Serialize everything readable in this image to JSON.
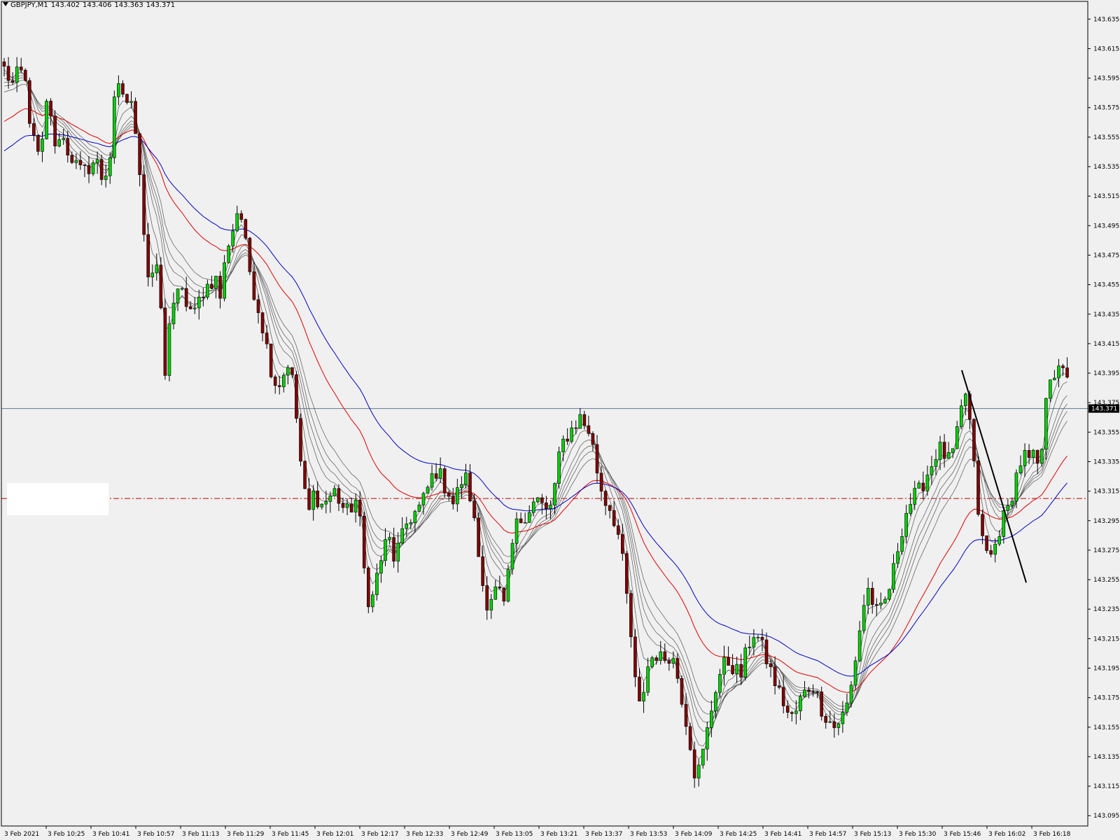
{
  "window": {
    "symbol": "GBPJPY,M1",
    "ohlc": [
      "143.402",
      "143.406",
      "143.363",
      "143.371"
    ]
  },
  "colors": {
    "background": "#f0f0f0",
    "bull": "#00d000",
    "bear": "#800000",
    "ema_red": "#e00000",
    "ema_blue": "#0000c8",
    "ema_gray": "#555555",
    "bid_line": "#607890",
    "level_line": "#c00000",
    "trendline": "#000000"
  },
  "chart_data": {
    "type": "candlestick",
    "y_range": [
      143.088,
      143.647
    ],
    "y_ticks": [
      "143.635",
      "143.615",
      "143.595",
      "143.575",
      "143.555",
      "143.535",
      "143.515",
      "143.495",
      "143.475",
      "143.455",
      "143.435",
      "143.415",
      "143.395",
      "143.375",
      "143.355",
      "143.335",
      "143.315",
      "143.295",
      "143.275",
      "143.255",
      "143.235",
      "143.215",
      "143.195",
      "143.175",
      "143.155",
      "143.135",
      "143.115",
      "143.095"
    ],
    "x_ticks": [
      "3 Feb 2021",
      "3 Feb 10:25",
      "3 Feb 10:41",
      "3 Feb 10:57",
      "3 Feb 11:13",
      "3 Feb 11:29",
      "3 Feb 11:45",
      "3 Feb 12:01",
      "3 Feb 12:17",
      "3 Feb 12:33",
      "3 Feb 12:49",
      "3 Feb 13:05",
      "3 Feb 13:21",
      "3 Feb 13:37",
      "3 Feb 13:53",
      "3 Feb 14:09",
      "3 Feb 14:25",
      "3 Feb 14:41",
      "3 Feb 14:57",
      "3 Feb 15:13",
      "3 Feb 15:30",
      "3 Feb 15:46",
      "3 Feb 16:02",
      "3 Feb 16:18"
    ],
    "bid_price": "143.371",
    "level_price": 143.31,
    "trendline": {
      "from": [
        1402,
        143.397
      ],
      "to": [
        1496,
        143.253
      ]
    },
    "anchors": [
      [
        0,
        143.605
      ],
      [
        8,
        143.6
      ],
      [
        18,
        143.59
      ],
      [
        28,
        143.6
      ],
      [
        36,
        143.595
      ],
      [
        44,
        143.565
      ],
      [
        52,
        143.545
      ],
      [
        60,
        143.54
      ],
      [
        66,
        143.575
      ],
      [
        72,
        143.58
      ],
      [
        80,
        143.545
      ],
      [
        88,
        143.56
      ],
      [
        96,
        143.548
      ],
      [
        104,
        143.542
      ],
      [
        112,
        143.535
      ],
      [
        120,
        143.53
      ],
      [
        130,
        143.535
      ],
      [
        140,
        143.54
      ],
      [
        150,
        143.525
      ],
      [
        160,
        143.54
      ],
      [
        168,
        143.585
      ],
      [
        176,
        143.588
      ],
      [
        184,
        143.58
      ],
      [
        192,
        143.575
      ],
      [
        200,
        143.555
      ],
      [
        206,
        143.52
      ],
      [
        212,
        143.475
      ],
      [
        218,
        143.455
      ],
      [
        226,
        143.47
      ],
      [
        234,
        143.445
      ],
      [
        240,
        143.385
      ],
      [
        246,
        143.43
      ],
      [
        254,
        143.445
      ],
      [
        264,
        143.45
      ],
      [
        274,
        143.44
      ],
      [
        284,
        143.435
      ],
      [
        294,
        143.45
      ],
      [
        304,
        143.455
      ],
      [
        314,
        143.46
      ],
      [
        322,
        143.445
      ],
      [
        330,
        143.48
      ],
      [
        338,
        143.49
      ],
      [
        346,
        143.505
      ],
      [
        352,
        143.5
      ],
      [
        360,
        143.475
      ],
      [
        368,
        143.455
      ],
      [
        376,
        143.44
      ],
      [
        386,
        143.42
      ],
      [
        394,
        143.4
      ],
      [
        404,
        143.385
      ],
      [
        414,
        143.395
      ],
      [
        422,
        143.405
      ],
      [
        430,
        143.375
      ],
      [
        436,
        143.345
      ],
      [
        442,
        143.318
      ],
      [
        450,
        143.3
      ],
      [
        458,
        143.315
      ],
      [
        468,
        143.305
      ],
      [
        478,
        143.31
      ],
      [
        488,
        143.315
      ],
      [
        498,
        143.305
      ],
      [
        508,
        143.3
      ],
      [
        518,
        143.31
      ],
      [
        526,
        143.29
      ],
      [
        532,
        143.255
      ],
      [
        540,
        143.235
      ],
      [
        548,
        143.255
      ],
      [
        556,
        143.27
      ],
      [
        566,
        143.285
      ],
      [
        574,
        143.27
      ],
      [
        584,
        143.28
      ],
      [
        594,
        143.295
      ],
      [
        604,
        143.3
      ],
      [
        614,
        143.305
      ],
      [
        622,
        143.315
      ],
      [
        630,
        143.325
      ],
      [
        638,
        143.33
      ],
      [
        646,
        143.32
      ],
      [
        654,
        143.315
      ],
      [
        662,
        143.305
      ],
      [
        670,
        143.32
      ],
      [
        678,
        143.325
      ],
      [
        686,
        143.31
      ],
      [
        694,
        143.285
      ],
      [
        702,
        143.255
      ],
      [
        710,
        143.24
      ],
      [
        718,
        143.245
      ],
      [
        726,
        143.25
      ],
      [
        734,
        143.235
      ],
      [
        742,
        143.26
      ],
      [
        750,
        143.29
      ],
      [
        758,
        143.295
      ],
      [
        766,
        143.3
      ],
      [
        774,
        143.305
      ],
      [
        782,
        143.31
      ],
      [
        790,
        143.305
      ],
      [
        798,
        143.3
      ],
      [
        806,
        143.31
      ],
      [
        814,
        143.335
      ],
      [
        822,
        143.35
      ],
      [
        830,
        143.355
      ],
      [
        838,
        143.36
      ],
      [
        846,
        143.365
      ],
      [
        852,
        143.36
      ],
      [
        860,
        143.355
      ],
      [
        866,
        143.34
      ],
      [
        872,
        143.325
      ],
      [
        880,
        143.31
      ],
      [
        888,
        143.305
      ],
      [
        896,
        143.295
      ],
      [
        904,
        143.28
      ],
      [
        912,
        143.25
      ],
      [
        918,
        143.225
      ],
      [
        924,
        143.195
      ],
      [
        930,
        143.165
      ],
      [
        938,
        143.18
      ],
      [
        946,
        143.2
      ],
      [
        956,
        143.205
      ],
      [
        966,
        143.2
      ],
      [
        974,
        143.205
      ],
      [
        982,
        143.2
      ],
      [
        990,
        143.185
      ],
      [
        998,
        143.165
      ],
      [
        1006,
        143.145
      ],
      [
        1012,
        143.125
      ],
      [
        1018,
        143.125
      ],
      [
        1026,
        143.14
      ],
      [
        1034,
        143.16
      ],
      [
        1042,
        143.18
      ],
      [
        1052,
        143.195
      ],
      [
        1060,
        143.2
      ],
      [
        1070,
        143.195
      ],
      [
        1080,
        143.19
      ],
      [
        1090,
        143.21
      ],
      [
        1100,
        143.22
      ],
      [
        1110,
        143.21
      ],
      [
        1118,
        143.2
      ],
      [
        1126,
        143.19
      ],
      [
        1134,
        143.18
      ],
      [
        1144,
        143.17
      ],
      [
        1152,
        143.16
      ],
      [
        1160,
        143.165
      ],
      [
        1168,
        143.175
      ],
      [
        1176,
        143.18
      ],
      [
        1184,
        143.185
      ],
      [
        1192,
        143.175
      ],
      [
        1200,
        143.165
      ],
      [
        1208,
        143.16
      ],
      [
        1216,
        143.155
      ],
      [
        1224,
        143.16
      ],
      [
        1232,
        143.165
      ],
      [
        1240,
        143.18
      ],
      [
        1248,
        143.205
      ],
      [
        1256,
        143.23
      ],
      [
        1264,
        143.25
      ],
      [
        1272,
        143.24
      ],
      [
        1280,
        143.23
      ],
      [
        1290,
        143.24
      ],
      [
        1300,
        143.255
      ],
      [
        1310,
        143.28
      ],
      [
        1320,
        143.3
      ],
      [
        1330,
        143.31
      ],
      [
        1340,
        143.315
      ],
      [
        1350,
        143.325
      ],
      [
        1360,
        143.335
      ],
      [
        1368,
        143.345
      ],
      [
        1376,
        143.34
      ],
      [
        1384,
        143.335
      ],
      [
        1392,
        143.345
      ],
      [
        1400,
        143.365
      ],
      [
        1406,
        143.385
      ],
      [
        1412,
        143.37
      ],
      [
        1418,
        143.34
      ],
      [
        1424,
        143.31
      ],
      [
        1430,
        143.285
      ],
      [
        1436,
        143.275
      ],
      [
        1444,
        143.27
      ],
      [
        1452,
        143.28
      ],
      [
        1460,
        143.295
      ],
      [
        1468,
        143.3
      ],
      [
        1476,
        143.315
      ],
      [
        1484,
        143.33
      ],
      [
        1492,
        143.34
      ],
      [
        1500,
        143.335
      ],
      [
        1508,
        143.338
      ],
      [
        1516,
        143.33
      ],
      [
        1522,
        143.35
      ],
      [
        1526,
        143.395
      ]
    ]
  }
}
